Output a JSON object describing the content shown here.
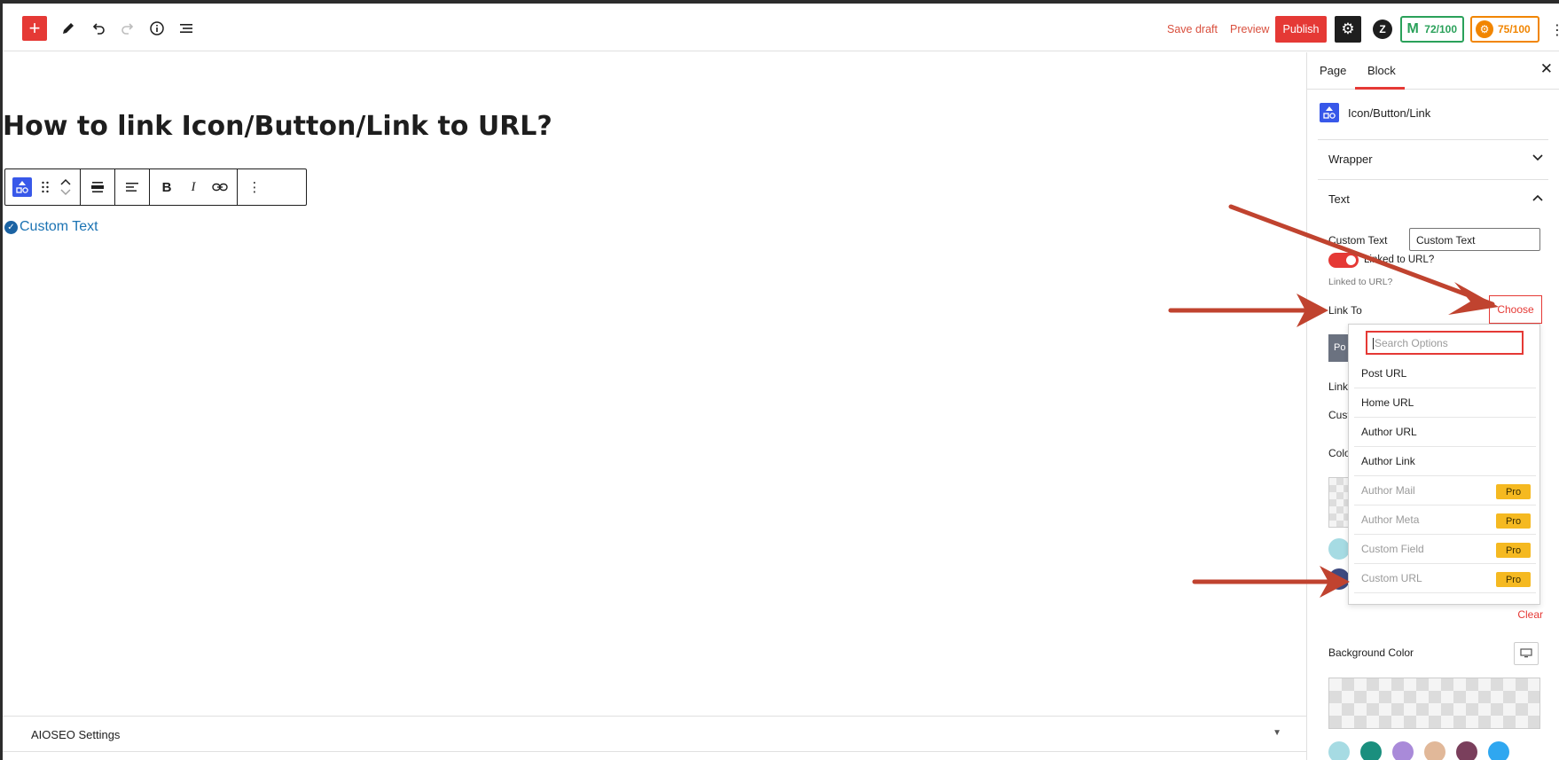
{
  "topbar": {
    "add_label": "+",
    "icons": [
      "pen-icon",
      "undo-icon",
      "redo-icon",
      "info-icon",
      "list-view-icon"
    ],
    "save_draft": "Save draft",
    "preview": "Preview",
    "publish": "Publish",
    "score_green": "72/100",
    "score_orange": "75/100",
    "accent_color": "#e53935"
  },
  "editor": {
    "title": "How to link Icon/Button/Link to URL?",
    "block_toolbar_icons": [
      "block-type-icon",
      "drag-handle-icon",
      "move-up-icon",
      "move-down-icon",
      "align-wide-icon",
      "text-align-left-icon",
      "bold-icon",
      "italic-icon",
      "link-icon",
      "more-options-icon"
    ],
    "bold_label": "B",
    "italic_label": "I",
    "custom_text": "Custom Text",
    "aioseo_label": "AIOSEO Settings"
  },
  "sidebar": {
    "tabs": [
      {
        "label": "Page"
      },
      {
        "label": "Block"
      }
    ],
    "active_tab": "Block",
    "block_title": "Icon/Button/Link",
    "sections": {
      "wrapper": "Wrapper",
      "text": "Text"
    },
    "custom_text_label": "Custom Text",
    "custom_text_value": "Custom Text",
    "linked_label": "Linked to URL?",
    "linked_help": "Linked to URL?",
    "linked_on": true,
    "link_to_label": "Link To",
    "choose_label": "Choose",
    "partial_chip": "Po",
    "partial_link": "Link",
    "partial_custom": "Cust",
    "partial_color": "Colo",
    "clear_label": "Clear",
    "background_label": "Background Color",
    "palette": [
      "#a6dbe3",
      "#1a8f7e",
      "#a98ad9",
      "#e1b899",
      "#7a3f5c",
      "#2fa7f0"
    ]
  },
  "dropdown": {
    "search_placeholder": "Search Options",
    "items": [
      {
        "label": "Post URL",
        "pro": false
      },
      {
        "label": "Home URL",
        "pro": false
      },
      {
        "label": "Author URL",
        "pro": false
      },
      {
        "label": "Author Link",
        "pro": false
      },
      {
        "label": "Author Mail",
        "pro": true
      },
      {
        "label": "Author Meta",
        "pro": true
      },
      {
        "label": "Custom Field",
        "pro": true
      },
      {
        "label": "Custom URL",
        "pro": true
      }
    ],
    "pro_label": "Pro"
  }
}
